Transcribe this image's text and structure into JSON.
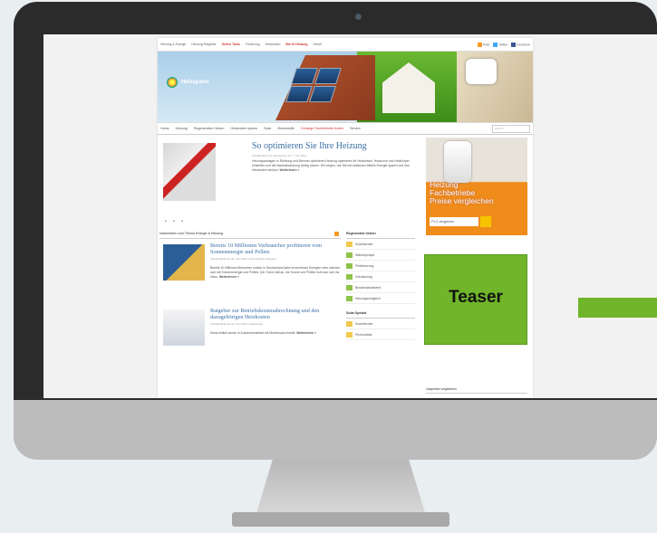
{
  "site": {
    "topnav": [
      "Heizung & Energie",
      "Heizung Ratgeber",
      "Online Tools",
      "Förderung",
      "Heizkosten",
      "Bio Ol Heizung",
      "Heizöl"
    ],
    "topnav_social": [
      "RSS",
      "Twitter",
      "Facebook"
    ],
    "logo": "Heizsparer",
    "mainnav": [
      "Home",
      "Heizung",
      "Regenerative Heizen",
      "Heizkosten sparen",
      "Solar",
      "Brennstoffe",
      "Günstige Fachbetriebe finden",
      "Service"
    ],
    "search_placeholder": "suchen",
    "featured": {
      "title": "So optimieren Sie Ihre Heizung",
      "meta": "Veröffentlicht von Heizsparer am 7. Juni 2011",
      "body": "Heizungsanlagen in Richtung und Brenner optimieren Heizung optimieren Ihr Heizkessel, Heizkurve und Heizkörper einstellen und die Nachtabsenkung richtig nutzen. Wir zeigen, wie Sie mit einfachen Mitteln Energie sparen und Ihre Heizkosten senken.",
      "more": "Weiterlesen »"
    },
    "slider_dots": "• • •",
    "news_head": "Nachrichten zum Thema Energie & Heizung",
    "news": [
      {
        "title": "Bereits 10 Millionen Verbraucher profitieren vom Sonnenenergie und Pellets",
        "meta": "Veröffentlicht am 29. Juni 2011 | Erneuerbare Energien",
        "body": "Bereits 10 Millionen Menschen nutzen in Deutschland aktiv erneuerbare Energien oder wärmen sich mit Sonnenenergie und Pellets. Der Trend hält an, die Sonne und Pellets holt man sich ins Haus.",
        "more": "Weiterlesen »"
      },
      {
        "title": "Ratgeber zur Betriebskostenabrechnung und den dazugehörigen Heizkosten",
        "meta": "Veröffentlicht am 22. Juni 2011 | Heizkosten",
        "body": "Diese Artikel wurde in Zusammenarbeit mit Mieterbund erstellt.",
        "more": "Weiterlesen »"
      }
    ],
    "middle": {
      "head": "Regenerativ heizen",
      "items": [
        "Solarthermie",
        "Wärmepumpe",
        "Pelletheizung",
        "Holzheizung",
        "Blockheizkraftwerk",
        "Heizungsvergleich"
      ],
      "head2": "Solar Spezial",
      "items2": [
        "Solarthermie",
        "Photovoltaik"
      ]
    },
    "ad": {
      "line1": "Heizung",
      "line2": "Fachbetriebe",
      "line3": "Preise vergleichen",
      "input_placeholder": "PLZ eingeben"
    },
    "right_head": "Gaspreise vergleichen"
  },
  "overlay": {
    "teaser_label": "Teaser"
  },
  "colors": {
    "accent_green": "#70b52a",
    "link_blue": "#3a6ea5",
    "ad_orange": "#f08c1a"
  }
}
